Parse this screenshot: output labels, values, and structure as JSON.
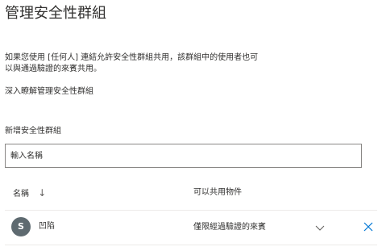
{
  "panel": {
    "title": "管理安全性群組",
    "description": "如果您使用 [任何人] 連結允許安全性群組共用，該群組中的使用者也可以與通過驗證的來賓共用。",
    "learn_more": "深入瞭解管理安全性群組"
  },
  "add_group": {
    "label": "新增安全性群組",
    "placeholder": "輸入名稱"
  },
  "table": {
    "columns": {
      "name": "名稱",
      "share": "可以共用物件"
    },
    "rows": [
      {
        "initial": "S",
        "name": "凹陷",
        "permission": "僅限經過驗證的來賓"
      }
    ]
  },
  "icons": {
    "sort": "arrow-down-icon",
    "dropdown": "chevron-down-icon",
    "remove": "close-icon"
  },
  "colors": {
    "avatar": "#5e6a70",
    "remove_icon": "#0078d4",
    "border": "#8a8886"
  }
}
